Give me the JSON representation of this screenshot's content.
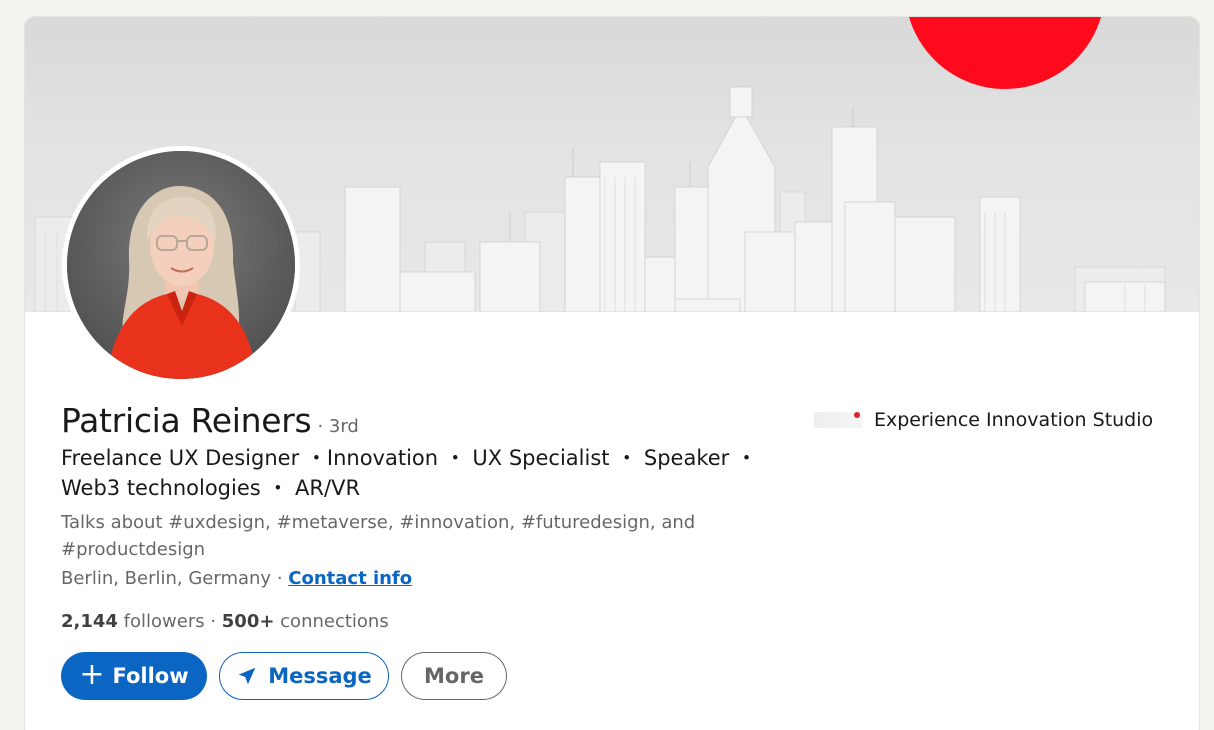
{
  "profile": {
    "name": "Patricia Reiners",
    "degree": "· 3rd",
    "headline": "Freelance UX Designer  ・Innovation  ・ UX Specialist  ・ Speaker  ・ Web3 technologies  ・ AR/VR",
    "talks_about": "Talks about #uxdesign, #metaverse, #innovation, #futuredesign, and #productdesign",
    "location": "Berlin, Berlin, Germany",
    "separator": " · ",
    "contact_info_label": "Contact info",
    "followers_count": "2,144",
    "followers_label": " followers ",
    "connections_sep": " · ",
    "connections_count": "500+",
    "connections_label": " connections"
  },
  "company": {
    "name": "Experience Innovation Studio",
    "logo_icon": "company-logo-icon"
  },
  "actions": {
    "follow_icon": "+",
    "follow_label": "Follow",
    "message_label": "Message",
    "more_label": "More"
  },
  "colors": {
    "accent": "#0a66c2",
    "banner_sun": "#ff0a1c",
    "shirt": "#e8321c"
  }
}
